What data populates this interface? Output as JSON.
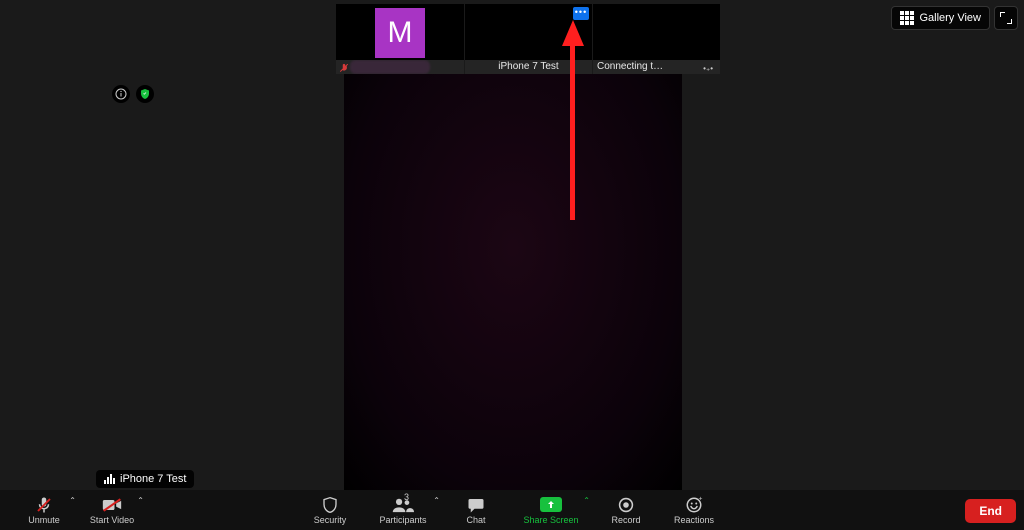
{
  "thumbnails": [
    {
      "avatar_letter": "M",
      "muted": true
    },
    {
      "label": "iPhone 7 Test"
    },
    {
      "label": "Connecting t…",
      "spinner": "•₊•"
    }
  ],
  "top_right": {
    "gallery_label": "Gallery View"
  },
  "audio_source": {
    "label": "iPhone 7 Test"
  },
  "toolbar": {
    "unmute": "Unmute",
    "start_video": "Start Video",
    "security": "Security",
    "participants": "Participants",
    "participants_count": "3",
    "chat": "Chat",
    "share_screen": "Share Screen",
    "record": "Record",
    "reactions": "Reactions",
    "end": "End"
  }
}
